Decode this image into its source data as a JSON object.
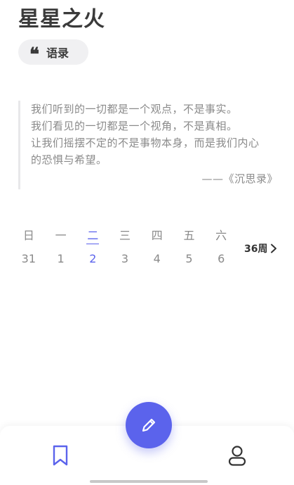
{
  "app": {
    "title": "星星之火"
  },
  "quote_chip": {
    "icon": "quote-icon",
    "icon_glyph": "❝",
    "label": "语录"
  },
  "quote": {
    "lines": [
      "我们听到的一切都是一个观点，不是事实。",
      "我们看见的一切都是一个视角，不是真相。",
      "让我们摇摆不定的不是事物本身，而是我们内心",
      "的恐惧与希望。"
    ],
    "source": "——《沉思录》"
  },
  "calendar": {
    "weekdays": [
      "日",
      "一",
      "二",
      "三",
      "四",
      "五",
      "六"
    ],
    "dates": [
      "31",
      "1",
      "2",
      "3",
      "4",
      "5",
      "6"
    ],
    "selected_index": 2,
    "week_label": "36周",
    "accent": "#5b63ec"
  },
  "bottom_nav": {
    "left_icon": "bookmark-icon",
    "center_icon": "pencil-icon",
    "right_icon": "profile-icon",
    "accent": "#5b63ec"
  }
}
